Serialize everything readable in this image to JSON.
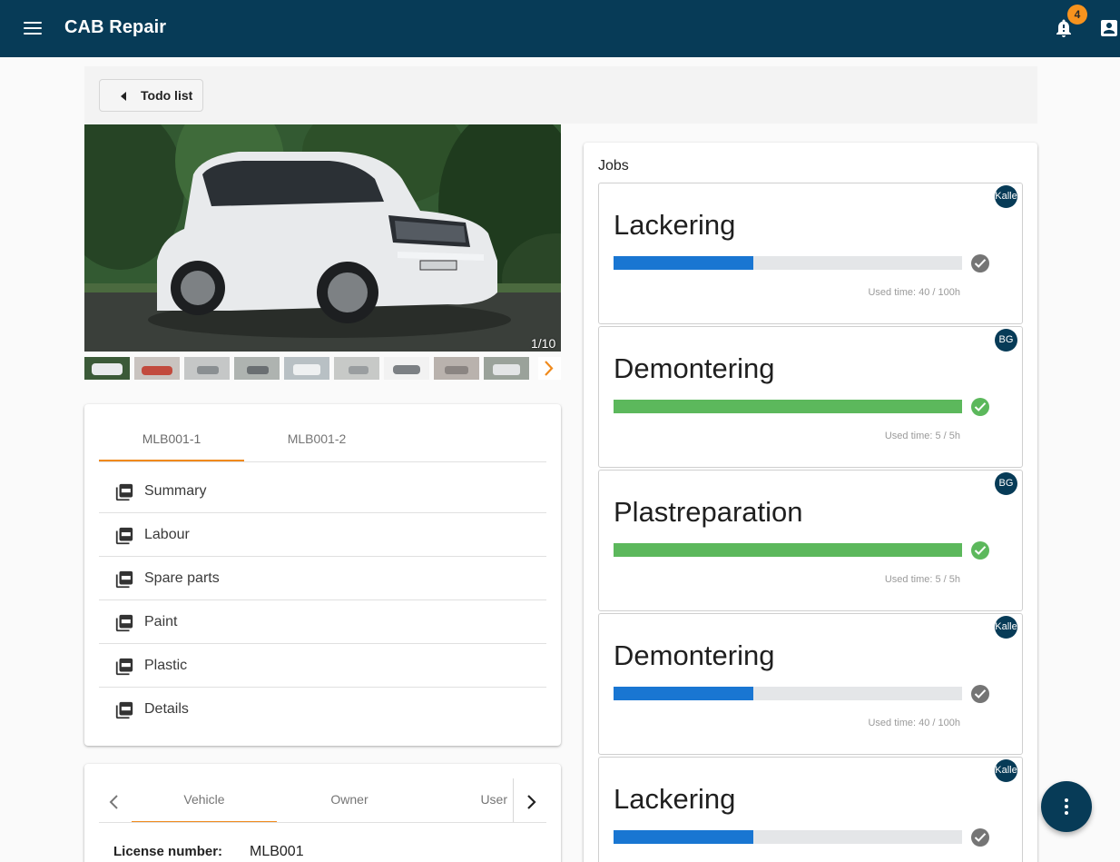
{
  "app": {
    "title": "CAB Repair",
    "notification_count": "4"
  },
  "nav": {
    "back_label": "Todo list"
  },
  "gallery": {
    "counter": "1/10",
    "thumbnail_count": 9
  },
  "documents": {
    "tabs": [
      "MLB001-1",
      "MLB001-2"
    ],
    "active_tab": 0,
    "items": [
      "Summary",
      "Labour",
      "Spare parts",
      "Paint",
      "Plastic",
      "Details"
    ]
  },
  "info": {
    "tabs": [
      "Vehicle",
      "Owner",
      "User"
    ],
    "active_tab": 0,
    "fields": [
      {
        "label": "License number:",
        "value": "MLB001"
      }
    ]
  },
  "jobs": {
    "title": "Jobs",
    "items": [
      {
        "title": "Lackering",
        "assignee": "Kalle",
        "used": "Used time: 40 / 100h",
        "progress": 0.4,
        "status": "in-progress"
      },
      {
        "title": "Demontering",
        "assignee": "BG",
        "used": "Used time: 5 / 5h",
        "progress": 1.0,
        "status": "done"
      },
      {
        "title": "Plastreparation",
        "assignee": "BG",
        "used": "Used time: 5 / 5h",
        "progress": 1.0,
        "status": "done"
      },
      {
        "title": "Demontering",
        "assignee": "Kalle",
        "used": "Used time: 40 / 100h",
        "progress": 0.4,
        "status": "in-progress"
      },
      {
        "title": "Lackering",
        "assignee": "Kalle",
        "used": "",
        "progress": 0.4,
        "status": "in-progress"
      }
    ]
  },
  "colors": {
    "topbar": "#073b57",
    "accent": "#f08a1c",
    "progress_in_progress": "#1976d2",
    "progress_done": "#5cb85c",
    "check_pending": "#757575",
    "check_done": "#5cb85c"
  },
  "icons": [
    "menu-icon",
    "bell-icon",
    "account-box-icon",
    "arrow-left-icon",
    "chevron-right-icon",
    "chevron-left-icon",
    "pdf-icon",
    "check-circle-icon",
    "more-vert-icon"
  ]
}
